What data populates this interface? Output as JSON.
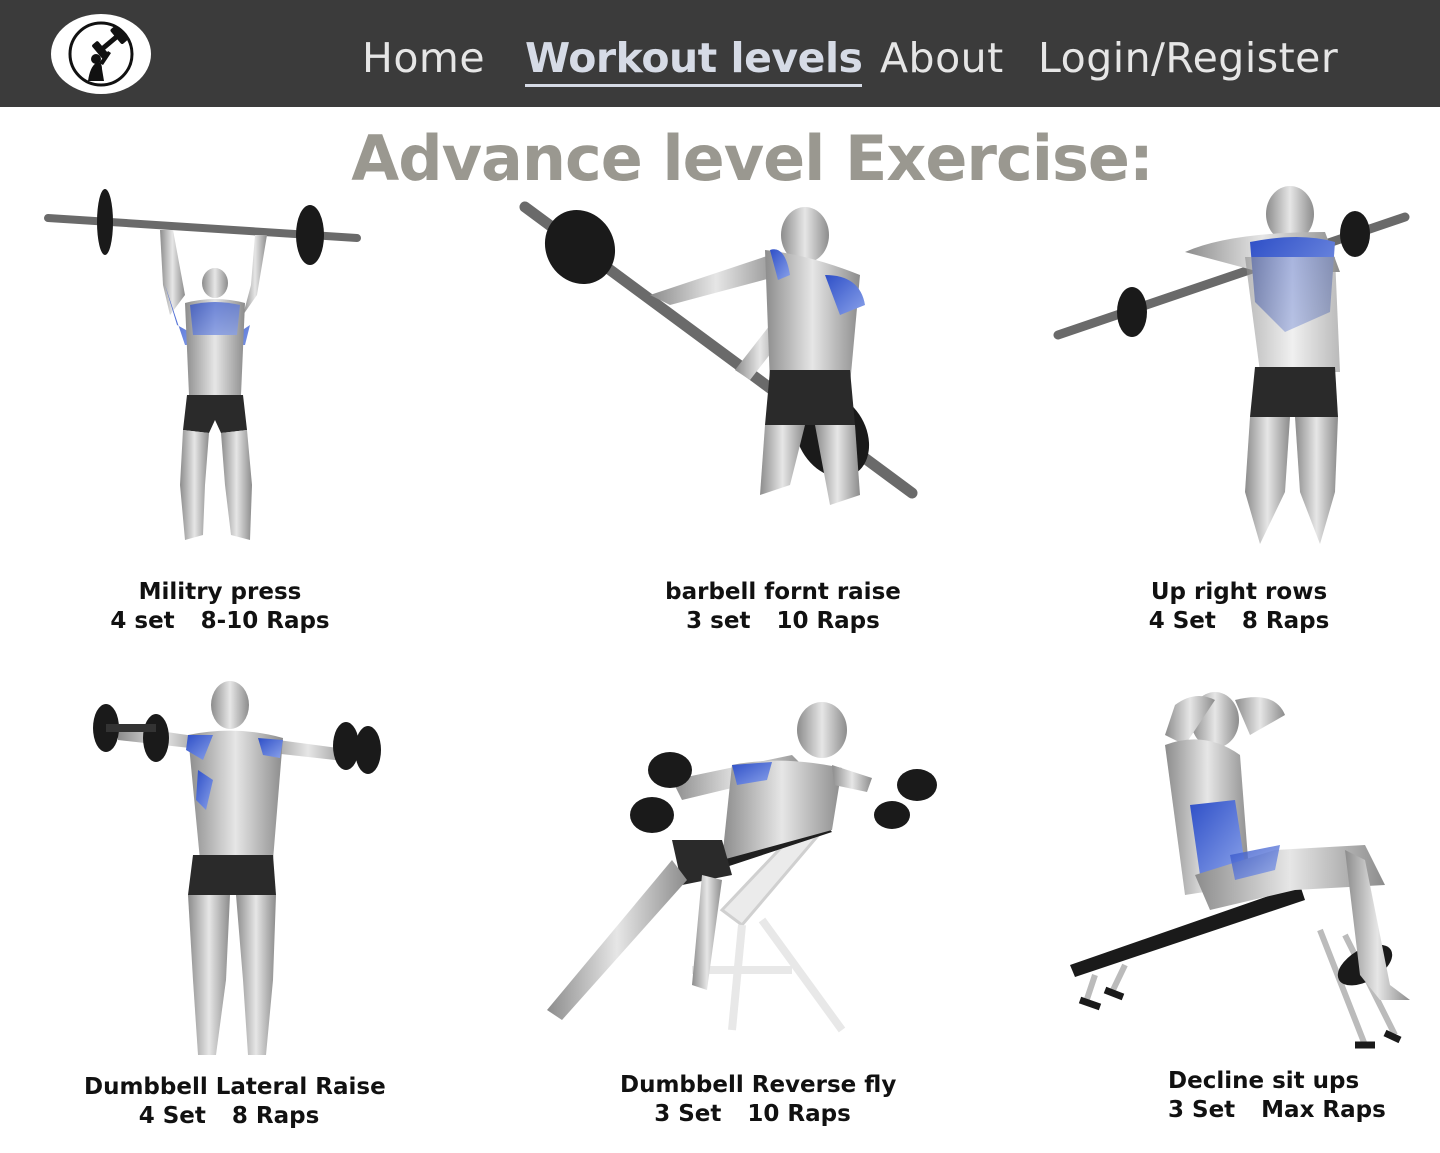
{
  "nav": {
    "logo_icon": "dumbbell-lifter-logo",
    "links": [
      "Home",
      "Workout levels",
      "About",
      "Login/Register"
    ],
    "active": "Workout levels"
  },
  "page": {
    "title": "Advance level Exercise:"
  },
  "colors": {
    "nav_bg": "#3b3b3b",
    "title": "#9a9890",
    "muscle_highlight": "#3d63d6"
  },
  "exercises": [
    {
      "name": "Militry press",
      "sets": "4 set",
      "reps": "8-10 Raps",
      "image": "military-press-illustration"
    },
    {
      "name": "barbell fornt raise",
      "sets": "3 set",
      "reps": "10 Raps",
      "image": "barbell-front-raise-illustration"
    },
    {
      "name": "Up right rows",
      "sets": "4 Set",
      "reps": "8 Raps",
      "image": "upright-rows-illustration"
    },
    {
      "name": "Dumbbell Lateral Raise",
      "sets": "4 Set",
      "reps": "8 Raps",
      "image": "dumbbell-lateral-raise-illustration"
    },
    {
      "name": "Dumbbell Reverse fly",
      "sets": "3 Set",
      "reps": "10 Raps",
      "image": "dumbbell-reverse-fly-illustration"
    },
    {
      "name": "Decline sit ups",
      "sets": "3 Set",
      "reps": "Max Raps",
      "image": "decline-sit-ups-illustration"
    }
  ]
}
